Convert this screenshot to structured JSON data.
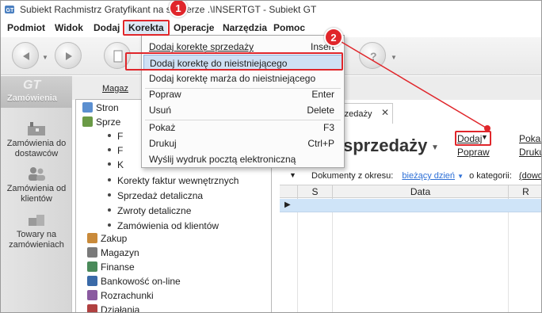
{
  "window": {
    "title": "Subiekt Rachmistrz Gratyfikant na serwerze .\\INSERTGT - Subiekt GT"
  },
  "menubar": {
    "items": [
      "Podmiot",
      "Widok",
      "Dodaj",
      "Korekta",
      "Operacje",
      "Narzędzia",
      "Pomoc"
    ]
  },
  "left_panel": {
    "header": "Zamówienia",
    "logo_text": "GT",
    "items": [
      {
        "label": "Zamówienia do dostawców",
        "icon": "factory-icon"
      },
      {
        "label": "Zamówienia od klientów",
        "icon": "people-icon"
      },
      {
        "label": "Towary na zamówieniach",
        "icon": "boxes-icon"
      }
    ]
  },
  "nav": {
    "tab_label": "Magaz",
    "tree": [
      {
        "label": "Stron",
        "type": "group",
        "color": "#5b8fd0"
      },
      {
        "label": "Sprze",
        "type": "group",
        "color": "#6a9a46"
      },
      {
        "label": "F",
        "type": "leaf"
      },
      {
        "label": "F",
        "type": "leaf"
      },
      {
        "label": "K",
        "type": "leaf"
      },
      {
        "label": "Korekty faktur wewnętrznych",
        "type": "leaf"
      },
      {
        "label": "Sprzedaż detaliczna",
        "type": "leaf"
      },
      {
        "label": "Zwroty detaliczne",
        "type": "leaf"
      },
      {
        "label": "Zamówienia od klientów",
        "type": "leaf"
      },
      {
        "label": "Zakup",
        "type": "group",
        "color": "#c98a3a"
      },
      {
        "label": "Magazyn",
        "type": "group",
        "color": "#7a7a7a"
      },
      {
        "label": "Finanse",
        "type": "group",
        "color": "#4a8a5a"
      },
      {
        "label": "Bankowość on-line",
        "type": "group",
        "color": "#3a6aa8"
      },
      {
        "label": "Rozrachunki",
        "type": "group",
        "color": "#8a5aa0"
      },
      {
        "label": "Działania",
        "type": "group",
        "color": "#b04040"
      }
    ]
  },
  "document": {
    "tab_label": "rzedaży",
    "title": "sprzedaży",
    "actions": {
      "dodaj": "Dodaj",
      "popraw": "Popraw",
      "pokaz": "Pokaz",
      "drukuj": "Druku"
    },
    "filter": {
      "label": "Dokumenty z okresu:",
      "period": "bieżący dzień",
      "category_label": "o kategorii:",
      "category_value": "(dowo"
    },
    "grid": {
      "columns": [
        "S",
        "Data",
        "R"
      ]
    }
  },
  "dropdown": {
    "items": [
      {
        "label": "Dodaj korektę sprzedaży",
        "shortcut": "Insert",
        "highlighted": false
      },
      {
        "label": "Dodaj korektę do nieistniejącego",
        "shortcut": "",
        "highlighted": true
      },
      {
        "label": "Dodaj korektę marża do nieistniejącego",
        "shortcut": "",
        "highlighted": false
      },
      {
        "label": "Popraw",
        "shortcut": "Enter",
        "highlighted": false
      },
      {
        "label": "Usuń",
        "shortcut": "Delete",
        "highlighted": false
      },
      {
        "label": "Pokaż",
        "shortcut": "F3",
        "highlighted": false
      },
      {
        "label": "Drukuj",
        "shortcut": "Ctrl+P",
        "highlighted": false
      },
      {
        "label": "Wyślij wydruk pocztą elektroniczną",
        "shortcut": "",
        "highlighted": false
      }
    ]
  },
  "annotations": {
    "badge1": "1",
    "badge2": "2",
    "color": "#e0262b"
  }
}
